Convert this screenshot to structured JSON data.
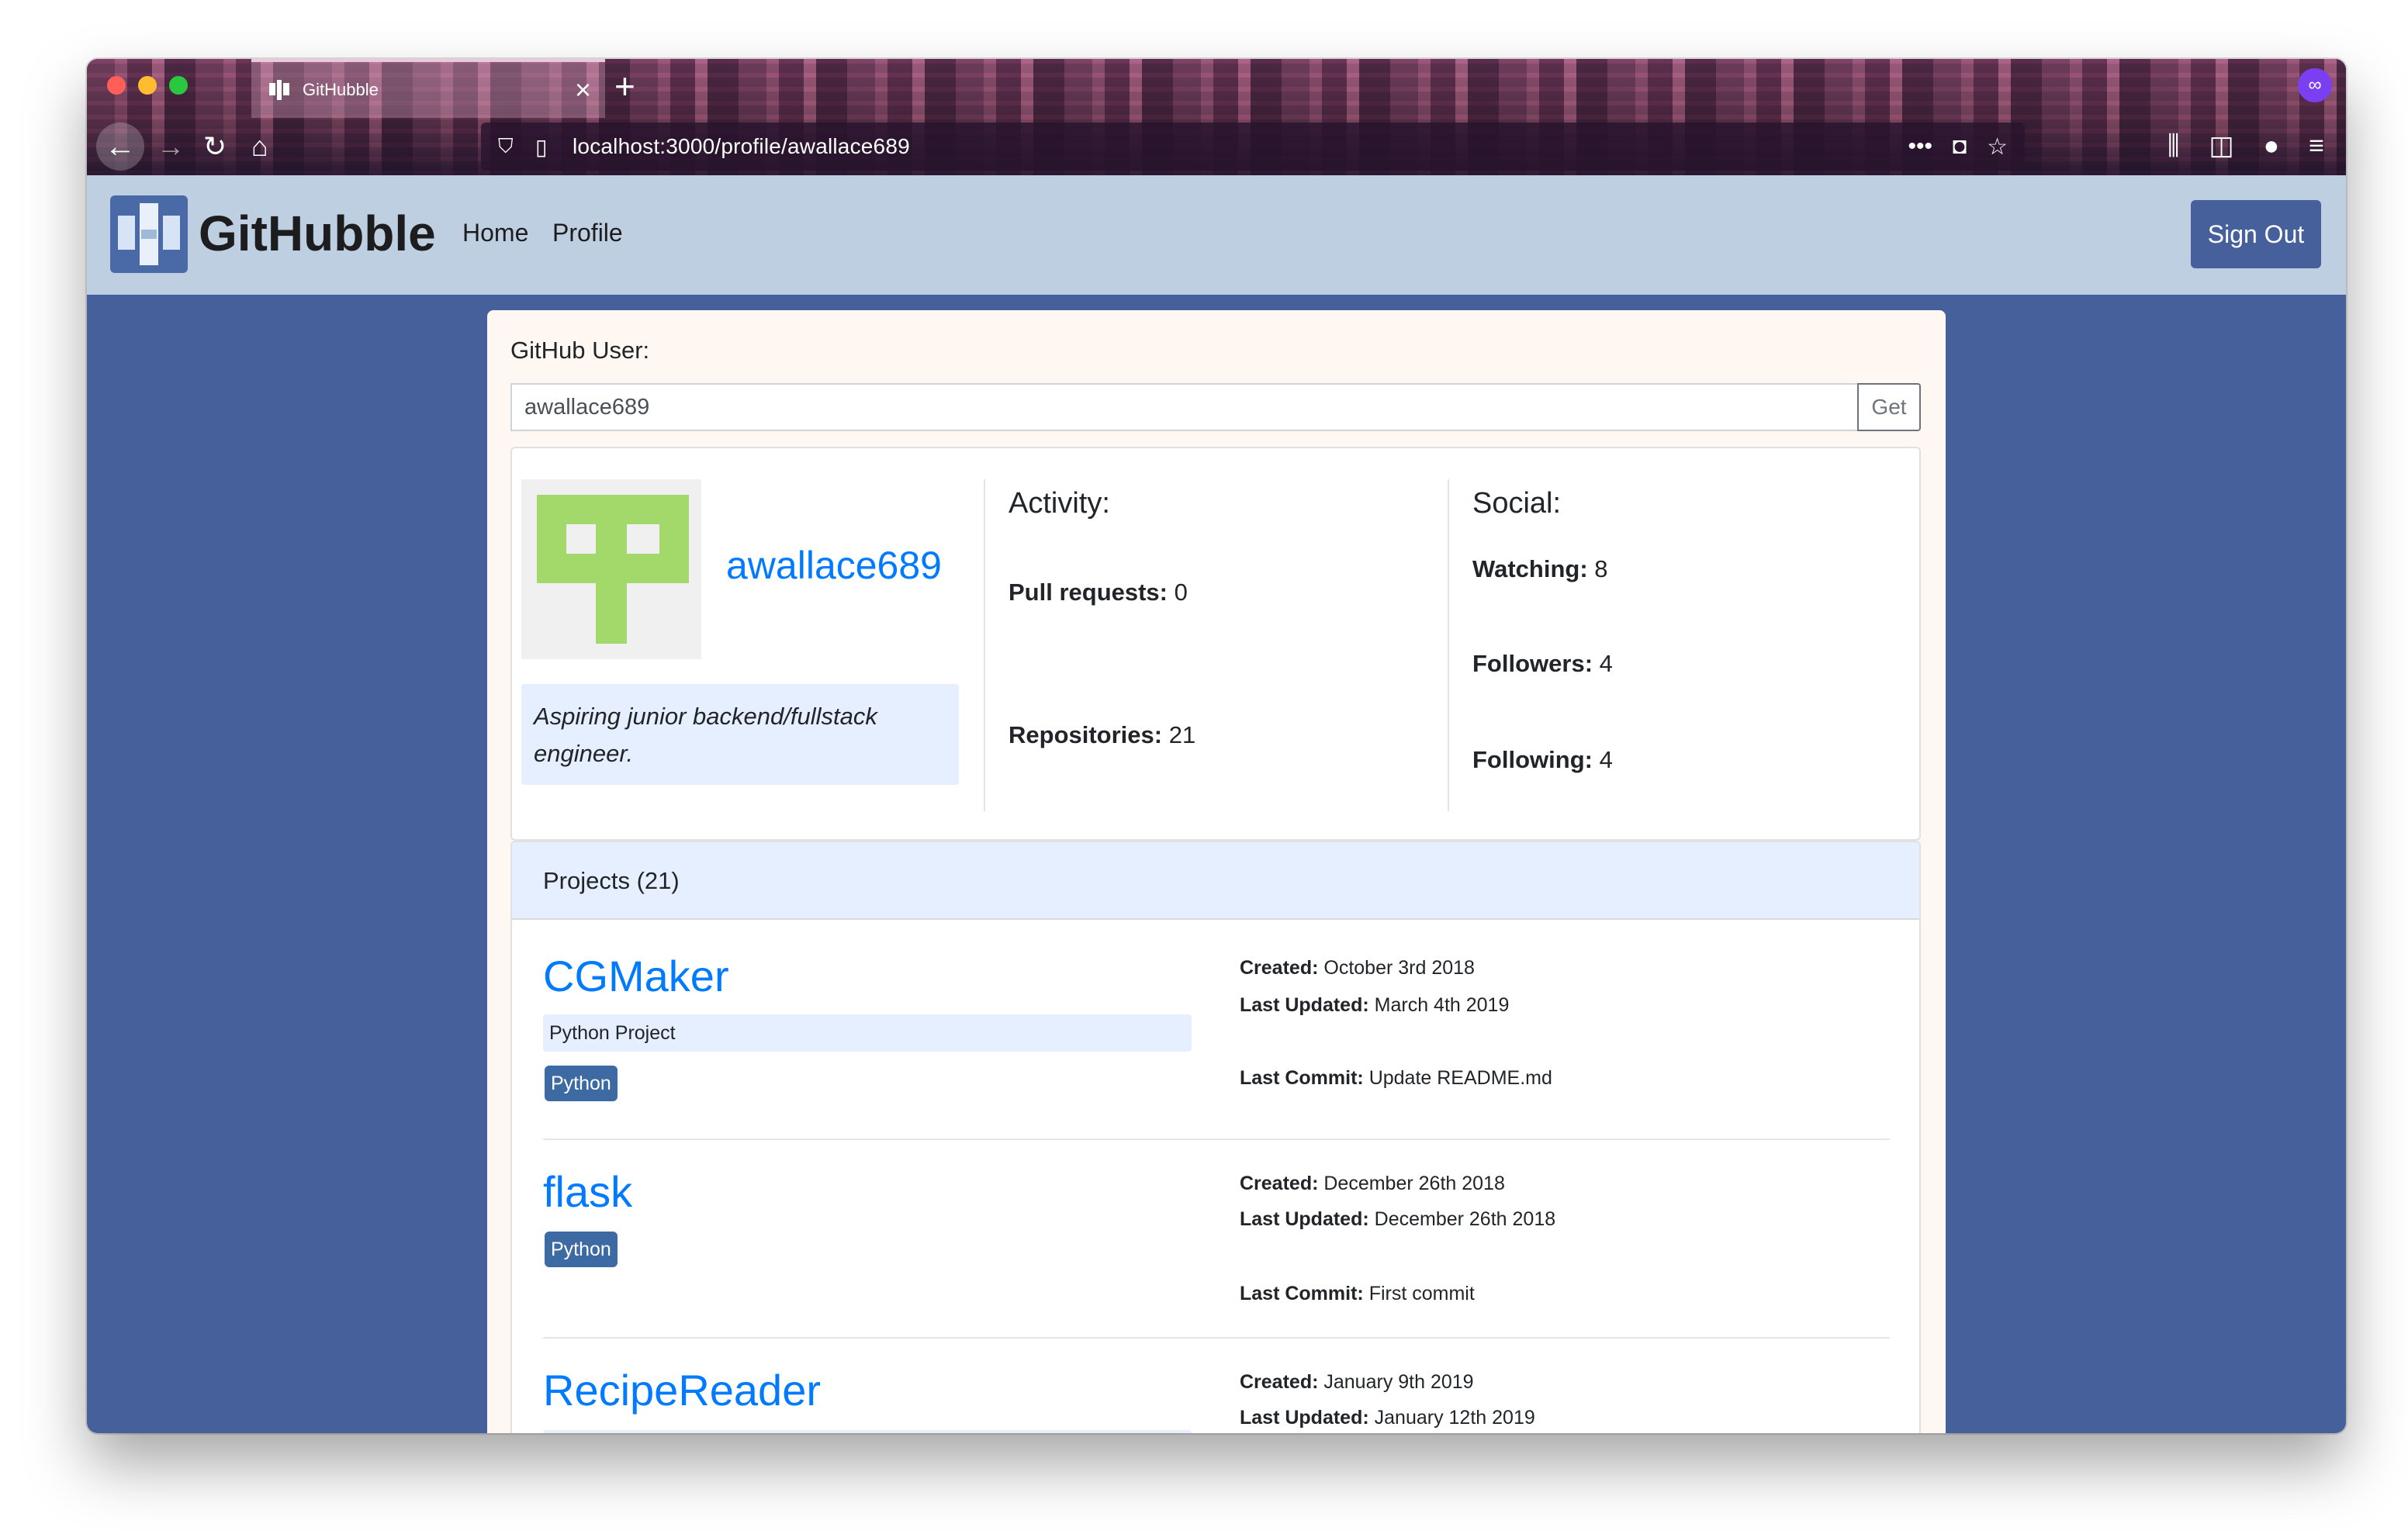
{
  "browser": {
    "tab_title": "GitHubble",
    "url": "localhost:3000/profile/awallace689",
    "new_tab": "+",
    "close": "×"
  },
  "navbar": {
    "brand": "GitHubble",
    "links": [
      "Home",
      "Profile"
    ],
    "signout": "Sign Out"
  },
  "search": {
    "label": "GitHub User:",
    "value": "awallace689",
    "button": "Get"
  },
  "profile": {
    "username": "awallace689",
    "bio": "Aspiring junior backend/fullstack engineer.",
    "activity_title": "Activity:",
    "social_title": "Social:",
    "pull_requests_label": "Pull requests:",
    "pull_requests": "0",
    "repositories_label": "Repositories:",
    "repositories": "21",
    "watching_label": "Watching:",
    "watching": "8",
    "followers_label": "Followers:",
    "followers": "4",
    "following_label": "Following:",
    "following": "4"
  },
  "projects": {
    "header": "Projects (21)",
    "created_label": "Created:",
    "updated_label": "Last Updated:",
    "commit_label": "Last Commit:",
    "items": [
      {
        "name": "CGMaker",
        "description": "Python Project",
        "language": "Python",
        "created": "October 3rd 2018",
        "updated": "March 4th 2019",
        "commit": "Update README.md"
      },
      {
        "name": "flask",
        "language": "Python",
        "created": "December 26th 2018",
        "updated": "December 26th 2018",
        "commit": "First commit"
      },
      {
        "name": "RecipeReader",
        "created": "January 9th 2019",
        "updated": "January 12th 2019"
      }
    ]
  },
  "colors": {
    "navbar_bg": "#bfcfe2",
    "page_bg": "#45609a",
    "link": "#007bff",
    "badge": "#3d6aa3",
    "avatar_green": "#a3d96a"
  }
}
